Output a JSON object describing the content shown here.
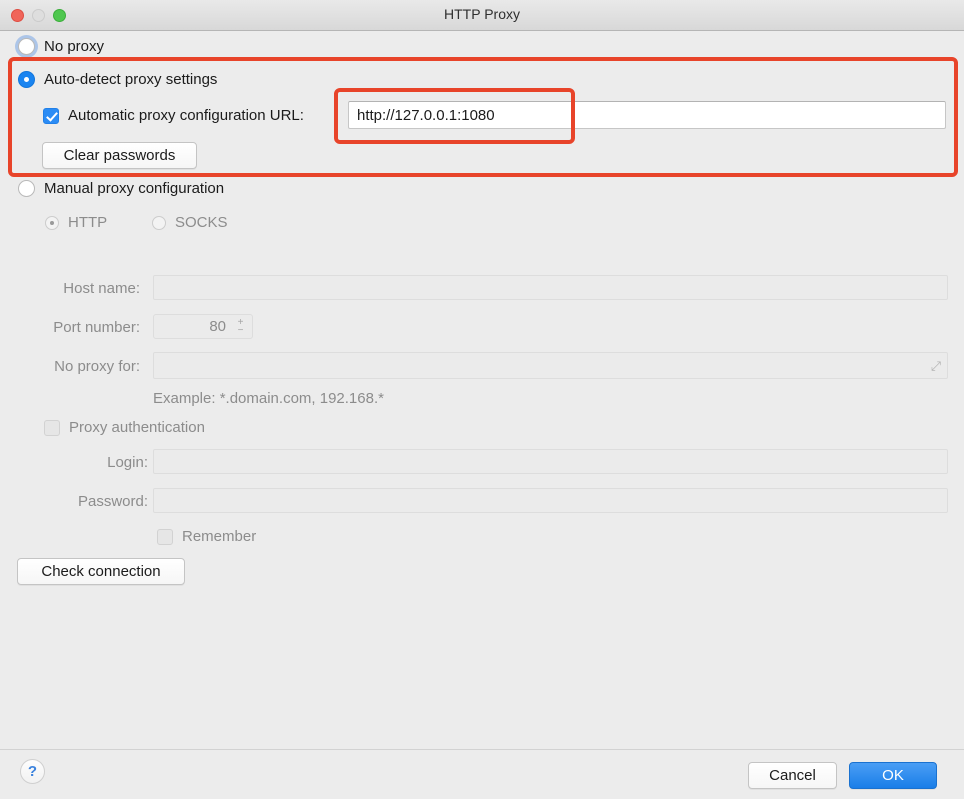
{
  "window": {
    "title": "HTTP Proxy",
    "traffic_lights": [
      "close-button",
      "minimize-button",
      "maximize-button"
    ]
  },
  "options": {
    "no_proxy": {
      "label": "No proxy",
      "selected": false,
      "focused": true
    },
    "auto_detect": {
      "label": "Auto-detect proxy settings",
      "selected": true,
      "auto_config": {
        "label": "Automatic proxy configuration URL:",
        "checked": true,
        "url_value": "http://127.0.0.1:1080",
        "url_placeholder": ""
      },
      "clear_passwords_label": "Clear passwords"
    },
    "manual": {
      "label": "Manual proxy configuration",
      "selected": false,
      "protocol": {
        "http_label": "HTTP",
        "socks_label": "SOCKS",
        "selected": "HTTP"
      },
      "host_name": {
        "label": "Host name:",
        "value": "",
        "placeholder": ""
      },
      "port_number": {
        "label": "Port number:",
        "value": "80",
        "increment_icon": "+",
        "decrement_icon": "−"
      },
      "no_proxy_for": {
        "label": "No proxy for:",
        "value": "",
        "placeholder": "",
        "expand_icon": "expand-icon"
      },
      "example_hint": "Example: *.domain.com, 192.168.*",
      "proxy_authentication": {
        "label": "Proxy authentication",
        "checked": false
      },
      "login": {
        "label": "Login:",
        "value": ""
      },
      "password": {
        "label": "Password:",
        "value": ""
      },
      "remember": {
        "label": "Remember",
        "checked": false
      }
    },
    "check_connection_label": "Check connection"
  },
  "footer": {
    "help_label": "?",
    "cancel_label": "Cancel",
    "ok_label": "OK"
  },
  "annotations": {
    "accent_color": "#e8442a",
    "boxes": [
      "auto-detect-section-highlight",
      "proxy-url-field-highlight"
    ]
  }
}
